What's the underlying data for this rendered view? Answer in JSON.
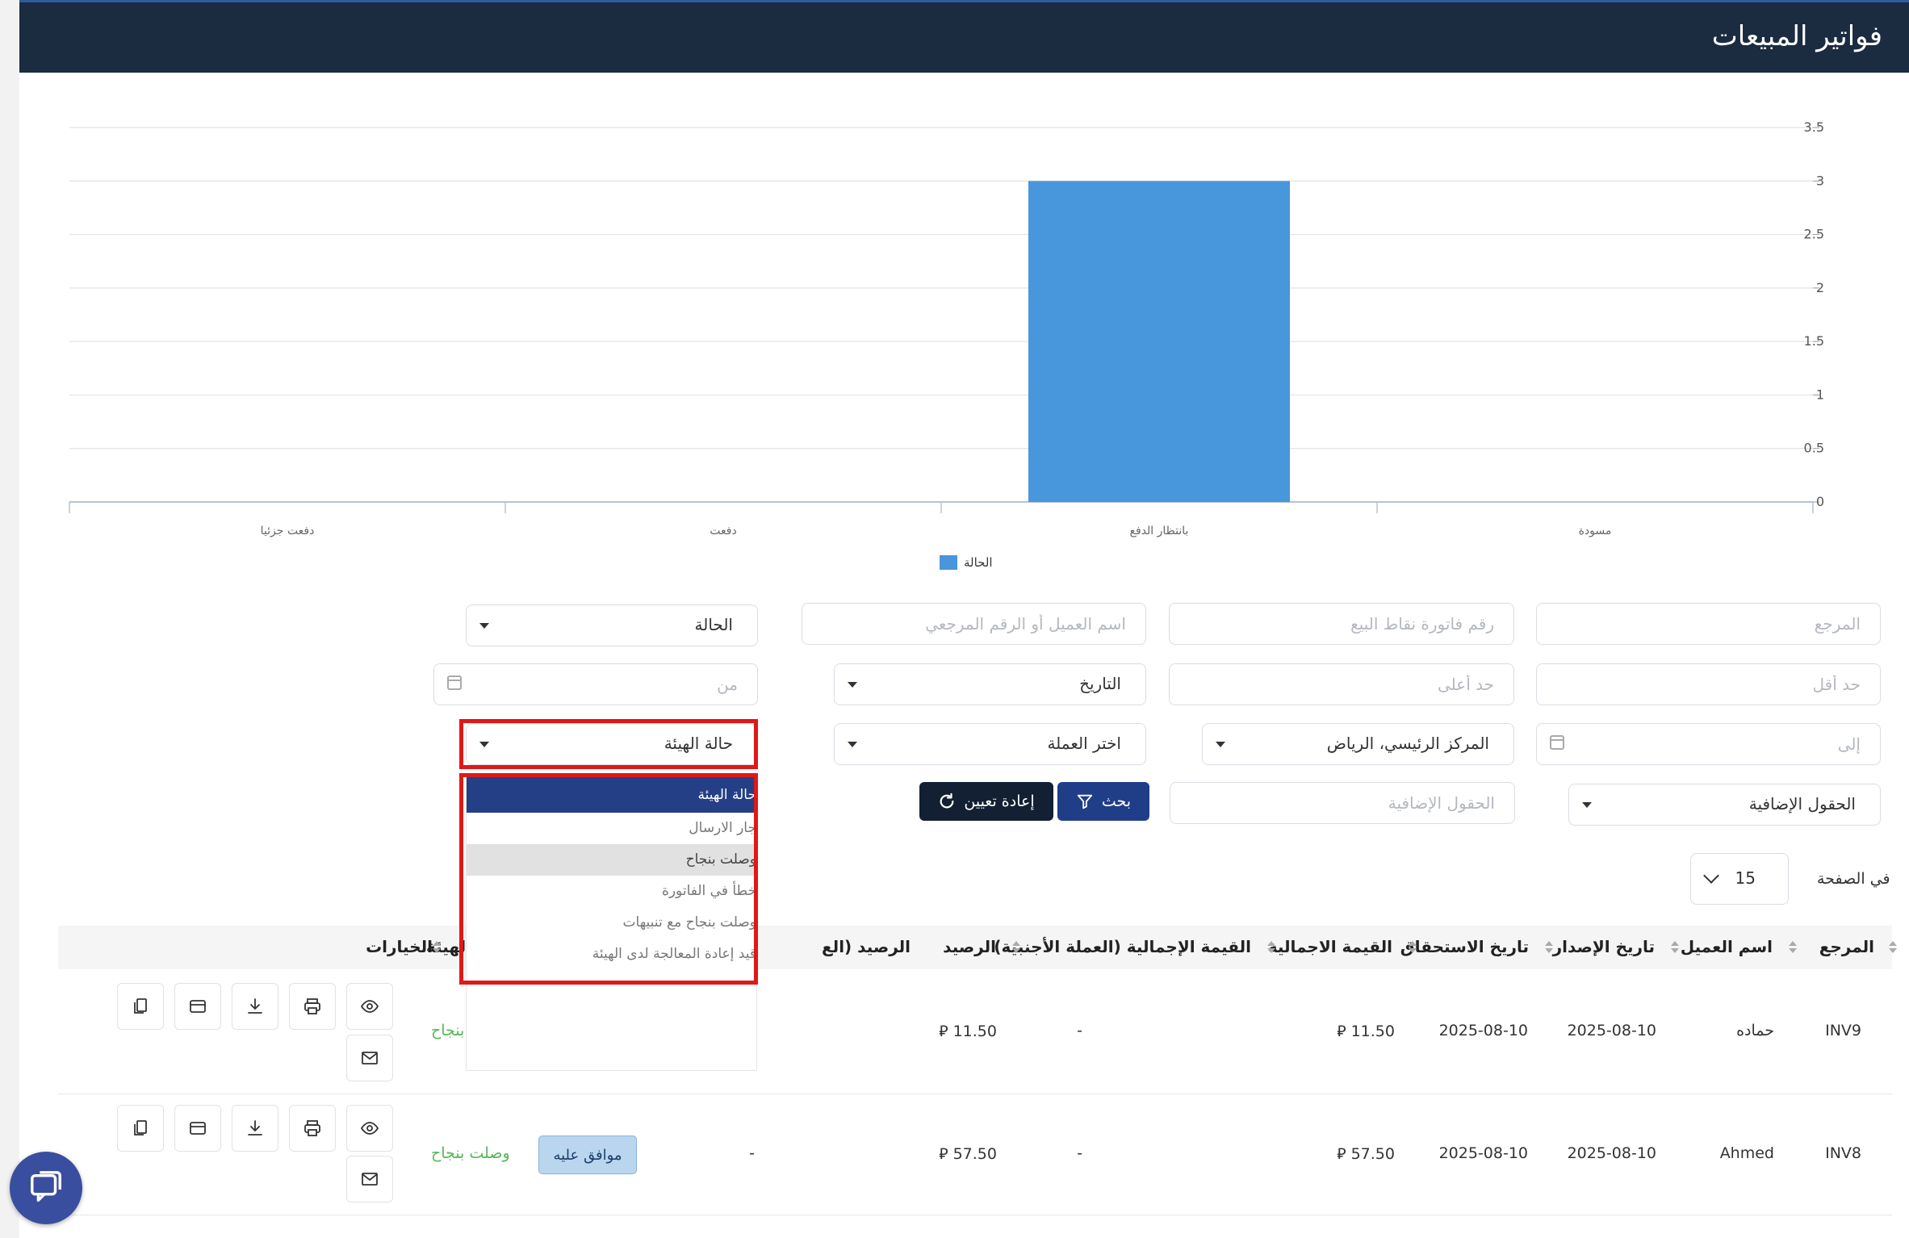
{
  "header": {
    "title": "فواتير المبيعات"
  },
  "chart_data": {
    "type": "bar",
    "categories": [
      "مسودة",
      "بانتظار الدفع",
      "دفعت",
      "دفعت جزئيا"
    ],
    "values": [
      0,
      3,
      0,
      0
    ],
    "series_name": "الحالة",
    "yticks": [
      "0",
      "0.5",
      "1",
      "1.5",
      "2",
      "2.5",
      "3",
      "3.5"
    ],
    "ylim": [
      0,
      3.5
    ],
    "legend_position": "bottom",
    "bar_color": "#4896db",
    "grid": true
  },
  "filters": {
    "reference_placeholder": "المرجع",
    "pos_invoice_placeholder": "رقم فاتورة نقاط البيع",
    "customer_placeholder": "اسم العميل أو الرقم المرجعي",
    "status_label": "الحالة",
    "min_placeholder": "حد أقل",
    "max_placeholder": "حد أعلى",
    "date_label": "التاريخ",
    "from_placeholder": "من",
    "to_placeholder": "إلى",
    "branch_label": "المركز الرئيسي، الرياض",
    "currency_label": "اختر العملة",
    "authority_status_label": "حالة الهيئة",
    "extra_fields_label": "الحقول الإضافية",
    "extra_fields_placeholder": "الحقول الإضافية",
    "search_label": "بحث",
    "reset_label": "إعادة تعيين"
  },
  "dropdown": {
    "items": [
      "حالة الهيئة",
      "جار الارسال",
      "وصلت بنجاح",
      "خطأ في الفاتورة",
      "وصلت بنجاح مع تنبيهات",
      "قيد إعادة المعالجة لدى الهيئة"
    ]
  },
  "pagination": {
    "per_page_label": "في الصفحة",
    "per_page_value": "15"
  },
  "table": {
    "headers": {
      "ref": "المرجع",
      "customer": "اسم العميل",
      "issue_date": "تاريخ الإصدار",
      "due_date": "تاريخ الاستحقاق",
      "total": "القيمة الاجمالية",
      "total_foreign": "القيمة الإجمالية (العملة الأجنبية)",
      "balance": "الرصيد",
      "balance_foreign": "الرصيد (الع",
      "authority": "الهيئة",
      "options": "الخيارات"
    },
    "rows": [
      {
        "ref": "INV9",
        "customer": "حماده",
        "issue_date": "2025-08-10",
        "due_date": "2025-08-10",
        "total": "11.50",
        "total_foreign": "-",
        "balance": "11.50",
        "balance_foreign": "",
        "badge": "",
        "authority": "ت بنجاح"
      },
      {
        "ref": "INV8",
        "customer": "Ahmed",
        "issue_date": "2025-08-10",
        "due_date": "2025-08-10",
        "total": "57.50",
        "total_foreign": "-",
        "balance": "57.50",
        "balance_foreign": "-",
        "badge": "موافق عليه",
        "authority": "وصلت بنجاح"
      }
    ],
    "currency_symbol": "⃁"
  }
}
